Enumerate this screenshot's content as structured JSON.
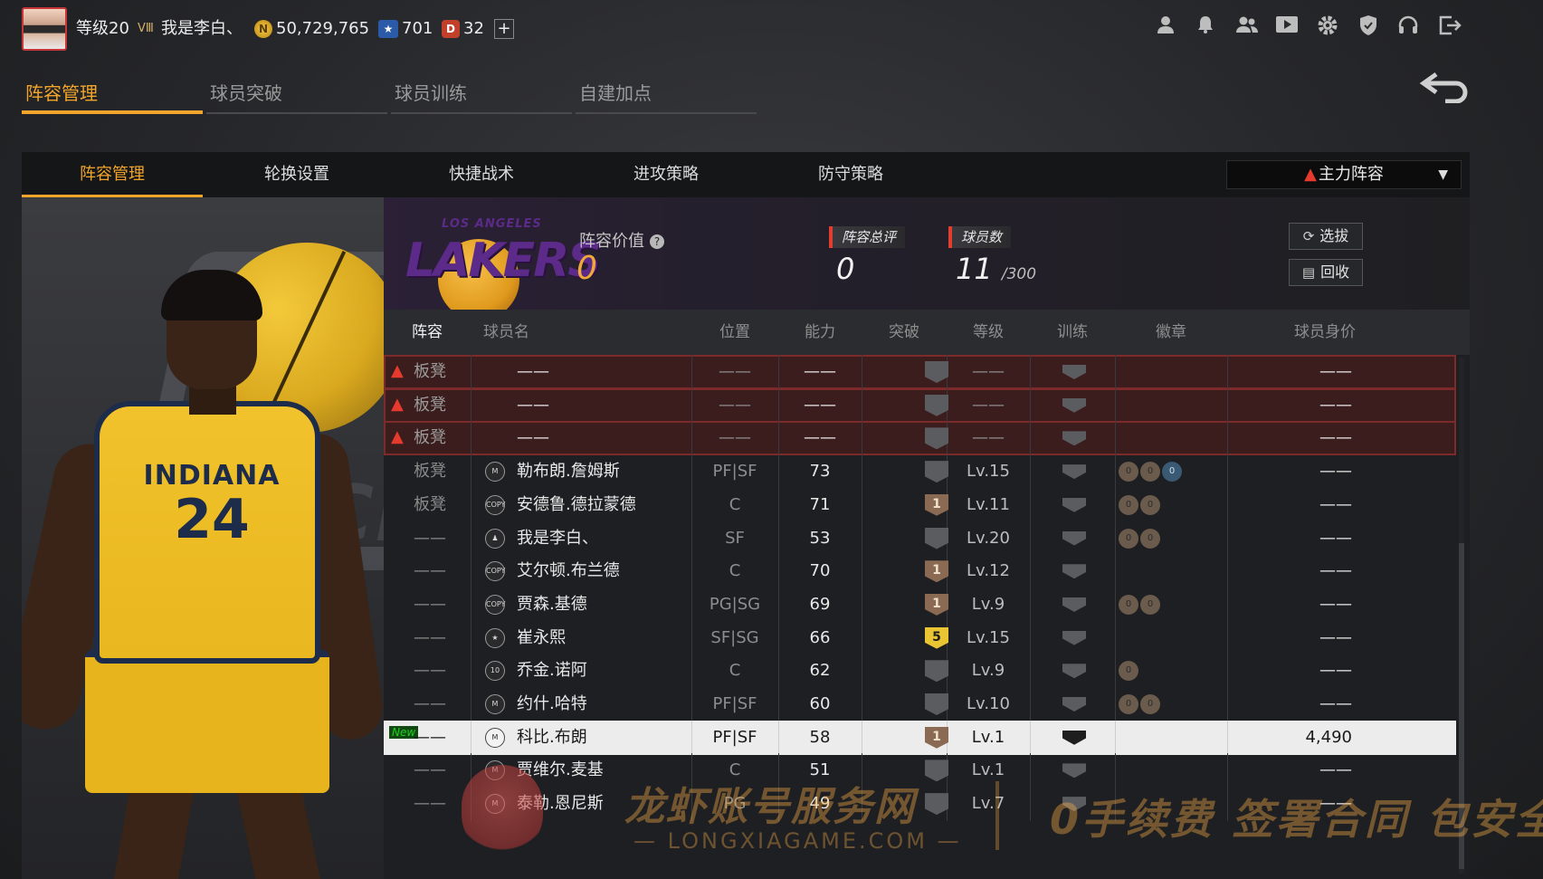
{
  "topbar": {
    "level": "等级20",
    "rank_mark": "Ⅲ",
    "username": "我是李白、",
    "coins": "50,729,765",
    "coin_symbol": "N",
    "stars": "701",
    "points": "32",
    "points_symbol": "D",
    "add": "+",
    "icons": [
      "profile-icon",
      "bell-icon",
      "friends-icon",
      "video-icon",
      "gear-icon",
      "shield-icon",
      "headset-icon",
      "exit-icon"
    ]
  },
  "main_tabs": [
    {
      "label": "阵容管理",
      "active": true
    },
    {
      "label": "球员突破",
      "active": false
    },
    {
      "label": "球员训练",
      "active": false
    },
    {
      "label": "自建加点",
      "active": false
    }
  ],
  "sub_tabs": [
    {
      "label": "阵容管理",
      "active": true
    },
    {
      "label": "轮换设置",
      "active": false
    },
    {
      "label": "快捷战术",
      "active": false
    },
    {
      "label": "进攻策略",
      "active": false
    },
    {
      "label": "防守策略",
      "active": false
    }
  ],
  "lineup_select": "主力阵容",
  "player_card": {
    "team": "INDIANA",
    "number": "24"
  },
  "team": {
    "logo_top": "LOS ANGELES",
    "logo_word": "LAKERS",
    "value_label": "阵容价值",
    "value": "0",
    "rating_label": "阵容总评",
    "rating": "0",
    "count_label": "球员数",
    "count": "11",
    "count_max": "/300",
    "draft_btn": "选拔",
    "recycle_btn": "回收"
  },
  "table": {
    "headers": [
      "阵容",
      "球员名",
      "位置",
      "能力",
      "突破",
      "等级",
      "训练",
      "徽章",
      "球员身价"
    ],
    "rows": [
      {
        "lineup": "板凳",
        "name": "——",
        "pos": "——",
        "ability": "——",
        "breakthrough": "",
        "level": "——",
        "badges": [],
        "value": "——",
        "alert": true
      },
      {
        "lineup": "板凳",
        "name": "——",
        "pos": "——",
        "ability": "——",
        "breakthrough": "",
        "level": "——",
        "badges": [],
        "value": "——",
        "alert": true
      },
      {
        "lineup": "板凳",
        "name": "——",
        "pos": "——",
        "ability": "——",
        "breakthrough": "",
        "level": "——",
        "badges": [],
        "value": "——",
        "alert": true
      },
      {
        "lineup": "板凳",
        "name": "勒布朗.詹姆斯",
        "icon": "M",
        "pos": "PF|SF",
        "ability": "73",
        "breakthrough": "",
        "level": "Lv.15",
        "badges": [
          "0",
          "0",
          "0b"
        ],
        "value": "——"
      },
      {
        "lineup": "板凳",
        "name": "安德鲁.德拉蒙德",
        "icon": "COPY",
        "pos": "C",
        "ability": "71",
        "breakthrough": "1",
        "level": "Lv.11",
        "badges": [
          "0",
          "0"
        ],
        "value": "——"
      },
      {
        "lineup": "——",
        "name": "我是李白、",
        "icon": "♟",
        "pos": "SF",
        "ability": "53",
        "breakthrough": "",
        "level": "Lv.20",
        "badges": [
          "0",
          "0"
        ],
        "value": "——"
      },
      {
        "lineup": "——",
        "name": "艾尔顿.布兰德",
        "icon": "COPY",
        "pos": "C",
        "ability": "70",
        "breakthrough": "1",
        "level": "Lv.12",
        "badges": [],
        "value": "——"
      },
      {
        "lineup": "——",
        "name": "贾森.基德",
        "icon": "COPY",
        "pos": "PG|SG",
        "ability": "69",
        "breakthrough": "1",
        "level": "Lv.9",
        "badges": [
          "0",
          "0"
        ],
        "value": "——"
      },
      {
        "lineup": "——",
        "name": "崔永熙",
        "icon": "★",
        "pos": "SF|SG",
        "ability": "66",
        "breakthrough": "5",
        "level": "Lv.15",
        "badges": [],
        "value": "——"
      },
      {
        "lineup": "——",
        "name": "乔金.诺阿",
        "icon": "10",
        "pos": "C",
        "ability": "62",
        "breakthrough": "",
        "level": "Lv.9",
        "badges": [
          "0"
        ],
        "value": "——"
      },
      {
        "lineup": "——",
        "name": "约什.哈特",
        "icon": "M",
        "pos": "PF|SF",
        "ability": "60",
        "breakthrough": "",
        "level": "Lv.10",
        "badges": [
          "0",
          "0"
        ],
        "value": "——"
      },
      {
        "lineup": "——",
        "name": "科比.布朗",
        "icon": "M",
        "pos": "PF|SF",
        "ability": "58",
        "breakthrough": "1",
        "level": "Lv.1",
        "badges": [],
        "value": "4,490",
        "selected": true,
        "new": "New"
      },
      {
        "lineup": "——",
        "name": "贾维尔.麦基",
        "icon": "M",
        "pos": "C",
        "ability": "51",
        "breakthrough": "",
        "level": "Lv.1",
        "badges": [],
        "value": "——"
      },
      {
        "lineup": "——",
        "name": "泰勒.恩尼斯",
        "icon": "M",
        "pos": "PG",
        "ability": "49",
        "breakthrough": "",
        "level": "Lv.7",
        "badges": [],
        "value": "——"
      }
    ]
  },
  "watermark": {
    "line1": "龙虾账号服务网",
    "line2": "— LONGXIAGAME.COM —",
    "line3": "0手续费 签署合同 包安全"
  }
}
